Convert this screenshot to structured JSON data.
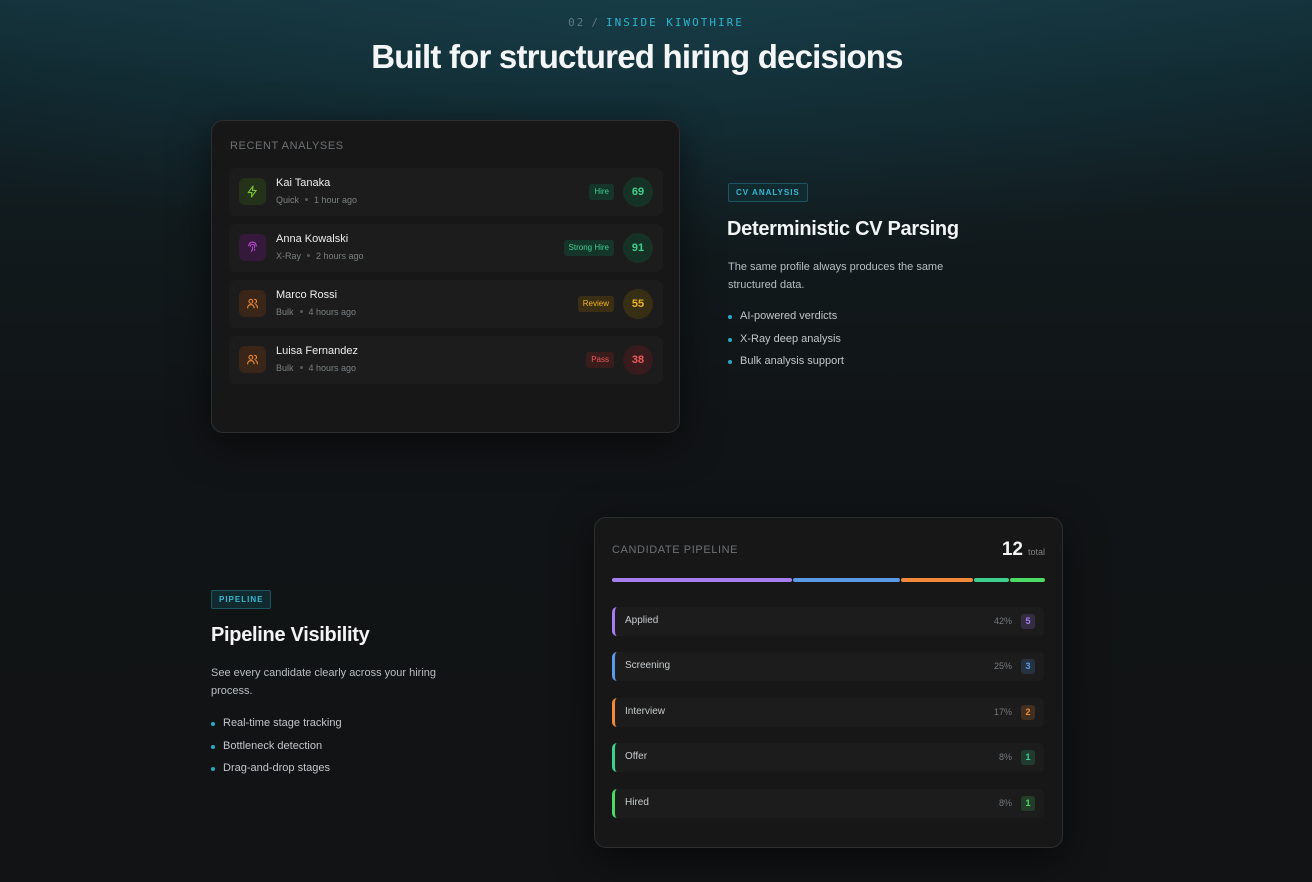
{
  "header": {
    "eyebrow_num": "02",
    "eyebrow_sep": "/",
    "eyebrow_text": "INSIDE KIWOTHIRE",
    "title": "Built for structured hiring decisions"
  },
  "analyses": {
    "label": "RECENT ANALYSES",
    "items": [
      {
        "name": "Kai Tanaka",
        "type": "Quick",
        "time": "1 hour ago",
        "verdict": "Hire",
        "score": "69",
        "icon": "bolt-icon"
      },
      {
        "name": "Anna Kowalski",
        "type": "X-Ray",
        "time": "2 hours ago",
        "verdict": "Strong Hire",
        "score": "91",
        "icon": "fingerprint-icon"
      },
      {
        "name": "Marco Rossi",
        "type": "Bulk",
        "time": "4 hours ago",
        "verdict": "Review",
        "score": "55",
        "icon": "users-icon"
      },
      {
        "name": "Luisa Fernandez",
        "type": "Bulk",
        "time": "4 hours ago",
        "verdict": "Pass",
        "score": "38",
        "icon": "users-icon"
      }
    ]
  },
  "cv_feature": {
    "tag": "CV ANALYSIS",
    "title": "Deterministic CV Parsing",
    "desc_line1": "The same profile always produces the same",
    "desc_line2": "structured data.",
    "bullets": [
      "AI-powered verdicts",
      "X-Ray deep analysis",
      "Bulk analysis support"
    ]
  },
  "pipeline_feature": {
    "tag": "PIPELINE",
    "title": "Pipeline Visibility",
    "desc_line1": "See every candidate clearly across your hiring",
    "desc_line2": "process.",
    "bullets": [
      "Real-time stage tracking",
      "Bottleneck detection",
      "Drag-and-drop stages"
    ]
  },
  "pipeline": {
    "label": "CANDIDATE PIPELINE",
    "total": "12",
    "total_label": "total",
    "stages": [
      {
        "name": "Applied",
        "pct": "42%",
        "count": "5",
        "color": "#a77ef0"
      },
      {
        "name": "Screening",
        "pct": "25%",
        "count": "3",
        "color": "#5a9ae6"
      },
      {
        "name": "Interview",
        "pct": "17%",
        "count": "2",
        "color": "#f08a3a"
      },
      {
        "name": "Offer",
        "pct": "8%",
        "count": "1",
        "color": "#3fcf8e"
      },
      {
        "name": "Hired",
        "pct": "8%",
        "count": "1",
        "color": "#4cd964"
      }
    ]
  },
  "colors": {
    "accent": "#2bb4cf",
    "hire": "#3fcf8e",
    "review": "#f0b323",
    "pass": "#f05a5a",
    "xray": "#c04bd8",
    "quick": "#7bc43a",
    "bulk": "#f08a3a"
  }
}
